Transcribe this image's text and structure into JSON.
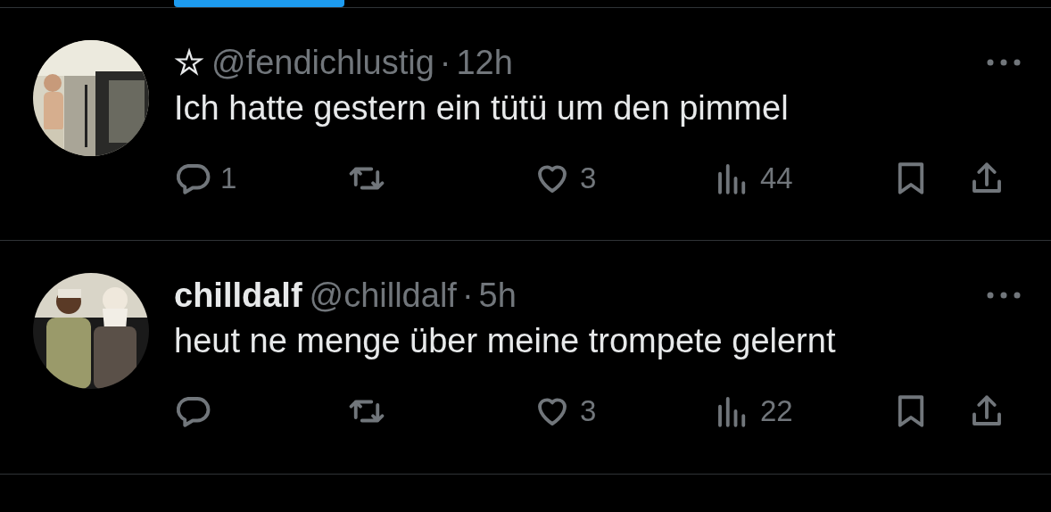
{
  "tweets": [
    {
      "display_name": "☆",
      "handle": "@fendichlustig",
      "separator": "·",
      "time": "12h",
      "text": "Ich hatte gestern ein tütü um den pimmel",
      "stats": {
        "replies": "1",
        "likes": "3",
        "views": "44"
      }
    },
    {
      "display_name": "chilldalf",
      "handle": "@chilldalf",
      "separator": "·",
      "time": "5h",
      "text": "heut ne menge über meine trompete gelernt",
      "stats": {
        "likes": "3",
        "views": "22"
      }
    }
  ]
}
